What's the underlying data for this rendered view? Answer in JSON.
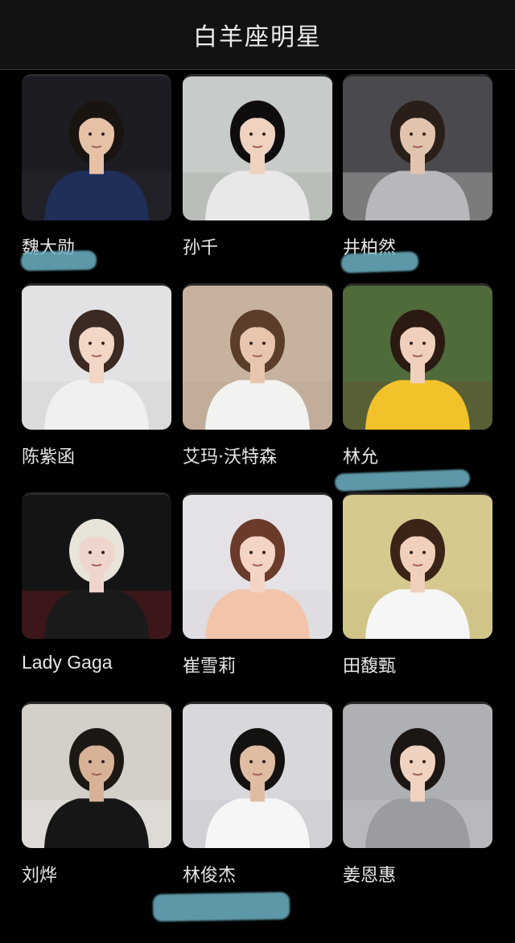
{
  "header": {
    "title": "白羊座明星"
  },
  "celebrities": [
    {
      "name": "魏大勋",
      "bg": "#1c1c22",
      "skin": "#e6c1a6",
      "hair": "#1a1410",
      "outfit": "#1f2f5a",
      "accent": "#2a2a32"
    },
    {
      "name": "孙千",
      "bg": "#c8ccc8",
      "skin": "#f0d2c0",
      "hair": "#0e0c0c",
      "outfit": "#e8e8e8",
      "accent": "#9ea69a"
    },
    {
      "name": "井柏然",
      "bg": "#4a4a4e",
      "skin": "#e2c4ae",
      "hair": "#2a1f18",
      "outfit": "#b8b8bc",
      "accent": "#d8d8d8"
    },
    {
      "name": "陈紫函",
      "bg": "#e2e2e4",
      "skin": "#f2d6c6",
      "hair": "#3a2a22",
      "outfit": "#f0f0f2",
      "accent": "#cfcfd2"
    },
    {
      "name": "艾玛·沃特森",
      "bg": "#c6b29e",
      "skin": "#e8c6ae",
      "hair": "#5a3e2a",
      "outfit": "#f2f2f0",
      "accent": "#b8a48e"
    },
    {
      "name": "林允",
      "bg": "#4f6b3a",
      "skin": "#f0d0bc",
      "hair": "#2a1a12",
      "outfit": "#f2c22a",
      "accent": "#6b4a2e"
    },
    {
      "name": "Lady Gaga",
      "bg": "#141414",
      "skin": "#efd6cc",
      "hair": "#e8e4da",
      "outfit": "#1a1a1a",
      "accent": "#8a1a22"
    },
    {
      "name": "崔雪莉",
      "bg": "#e4e2e6",
      "skin": "#f4d4c4",
      "hair": "#6a3a2a",
      "outfit": "#f2c4aa",
      "accent": "#d8d4da"
    },
    {
      "name": "田馥甄",
      "bg": "#d6c98e",
      "skin": "#f0d0bc",
      "hair": "#3a2418",
      "outfit": "#f6f6f6",
      "accent": "#c8bb80"
    },
    {
      "name": "刘烨",
      "bg": "#d4cfc8",
      "skin": "#d8b296",
      "hair": "#1c1814",
      "outfit": "#161616",
      "accent": "#f2f2f2"
    },
    {
      "name": "林俊杰",
      "bg": "#d8d8dc",
      "skin": "#e0bca2",
      "hair": "#141210",
      "outfit": "#f6f6f6",
      "accent": "#c4c4c8"
    },
    {
      "name": "姜恩惠",
      "bg": "#aeb0b4",
      "skin": "#f0d2c0",
      "hair": "#1c1614",
      "outfit": "#9a9ca2",
      "accent": "#c8cacc"
    }
  ],
  "highlight_color": "#6fb3c6"
}
